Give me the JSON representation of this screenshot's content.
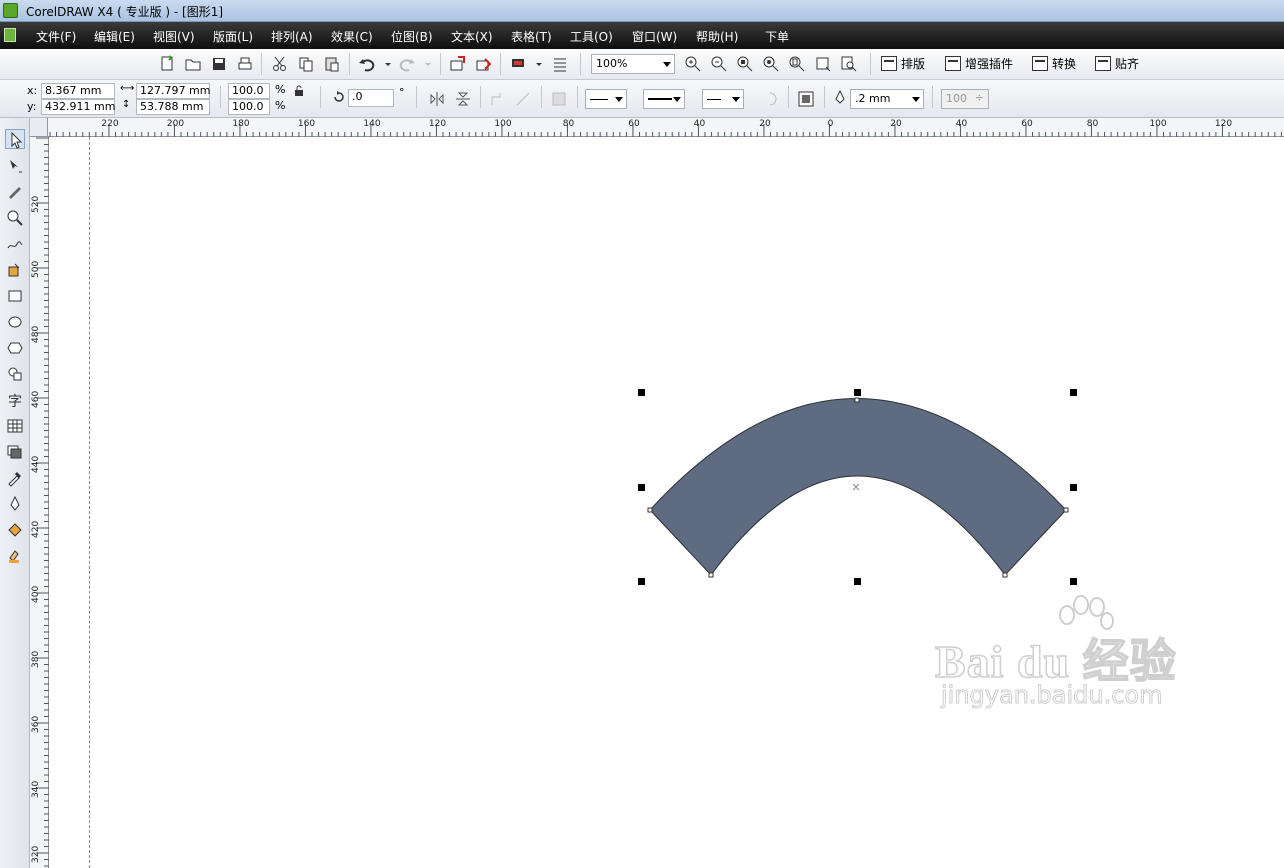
{
  "window": {
    "title": "CorelDRAW X4 ( 专业版 ) - [图形1]"
  },
  "menu": {
    "items": [
      "文件(F)",
      "编辑(E)",
      "视图(V)",
      "版面(L)",
      "排列(A)",
      "效果(C)",
      "位图(B)",
      "文本(X)",
      "表格(T)",
      "工具(O)",
      "窗口(W)",
      "帮助(H)",
      "下单"
    ]
  },
  "toolbar": {
    "zoom": "100%",
    "plugins": [
      "排版",
      "增强插件",
      "转换",
      "贴齐"
    ]
  },
  "properties": {
    "x_label": "x:",
    "x_value": "8.367 mm",
    "y_label": "y:",
    "y_value": "432.911 mm",
    "width_value": "127.797 mm",
    "height_value": "53.788 mm",
    "scale_x": "100.0",
    "scale_y": "100.0",
    "percent": "%",
    "rotation": ".0",
    "degree": "°",
    "outline_width": ".2 mm",
    "transparency": "100"
  },
  "rulers": {
    "horizontal": [
      "220",
      "200",
      "180",
      "160",
      "140",
      "120",
      "100",
      "80",
      "60",
      "40",
      "20",
      "0",
      "20",
      "40",
      "60",
      "80",
      "100",
      "120"
    ],
    "vertical": [
      "520",
      "500",
      "480",
      "460",
      "440",
      "420",
      "400",
      "380",
      "360",
      "340",
      "320"
    ]
  },
  "canvas": {
    "fill_color": "#5f6b80"
  },
  "watermark": {
    "brand": "Bai du 经验",
    "url": "jingyan.baidu.com"
  },
  "tools": [
    "pick-tool-icon",
    "shape-tool-icon",
    "smudge-tool-icon",
    "zoom-tool-icon",
    "freehand-tool-icon",
    "smart-fill-icon",
    "rectangle-tool-icon",
    "ellipse-tool-icon",
    "polygon-tool-icon",
    "basic-shapes-icon",
    "text-tool-icon",
    "table-tool-icon",
    "interactive-blend-icon",
    "eyedropper-icon",
    "outline-pen-icon",
    "fill-tool-icon",
    "interactive-fill-icon"
  ]
}
